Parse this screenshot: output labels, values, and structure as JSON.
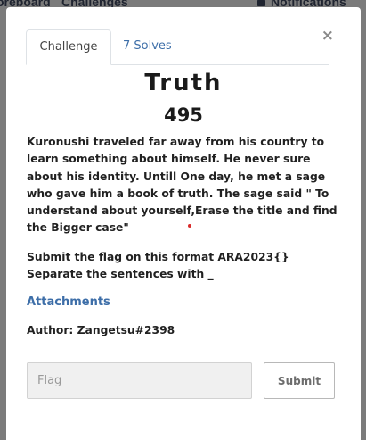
{
  "topbar": {
    "scoreboard": "oreboard",
    "challenges": "Challenges",
    "notifications": "Notifications"
  },
  "modal": {
    "close_label": "×",
    "tabs": [
      {
        "label": "Challenge",
        "active": true
      },
      {
        "label": "7 Solves",
        "active": false
      }
    ],
    "title": "Truth",
    "value": "495",
    "description": "Kuronushi traveled far away from his country to learn something about himself. He never sure about his identity. Untill One day, he met a sage who gave him a book of truth. The sage said \" To understand about yourself,Erase the title and find the Bigger case\"",
    "instruction": "Submit the flag on this format ARA2023{} Separate the sentences with _",
    "attachments_label": "Attachments",
    "author": "Author: Zangetsu#2398",
    "flag_placeholder": "Flag",
    "submit_label": "Submit"
  },
  "colors": {
    "backdrop": "#7b7b7b",
    "link": "#3d6ea8",
    "text": "#212121"
  }
}
